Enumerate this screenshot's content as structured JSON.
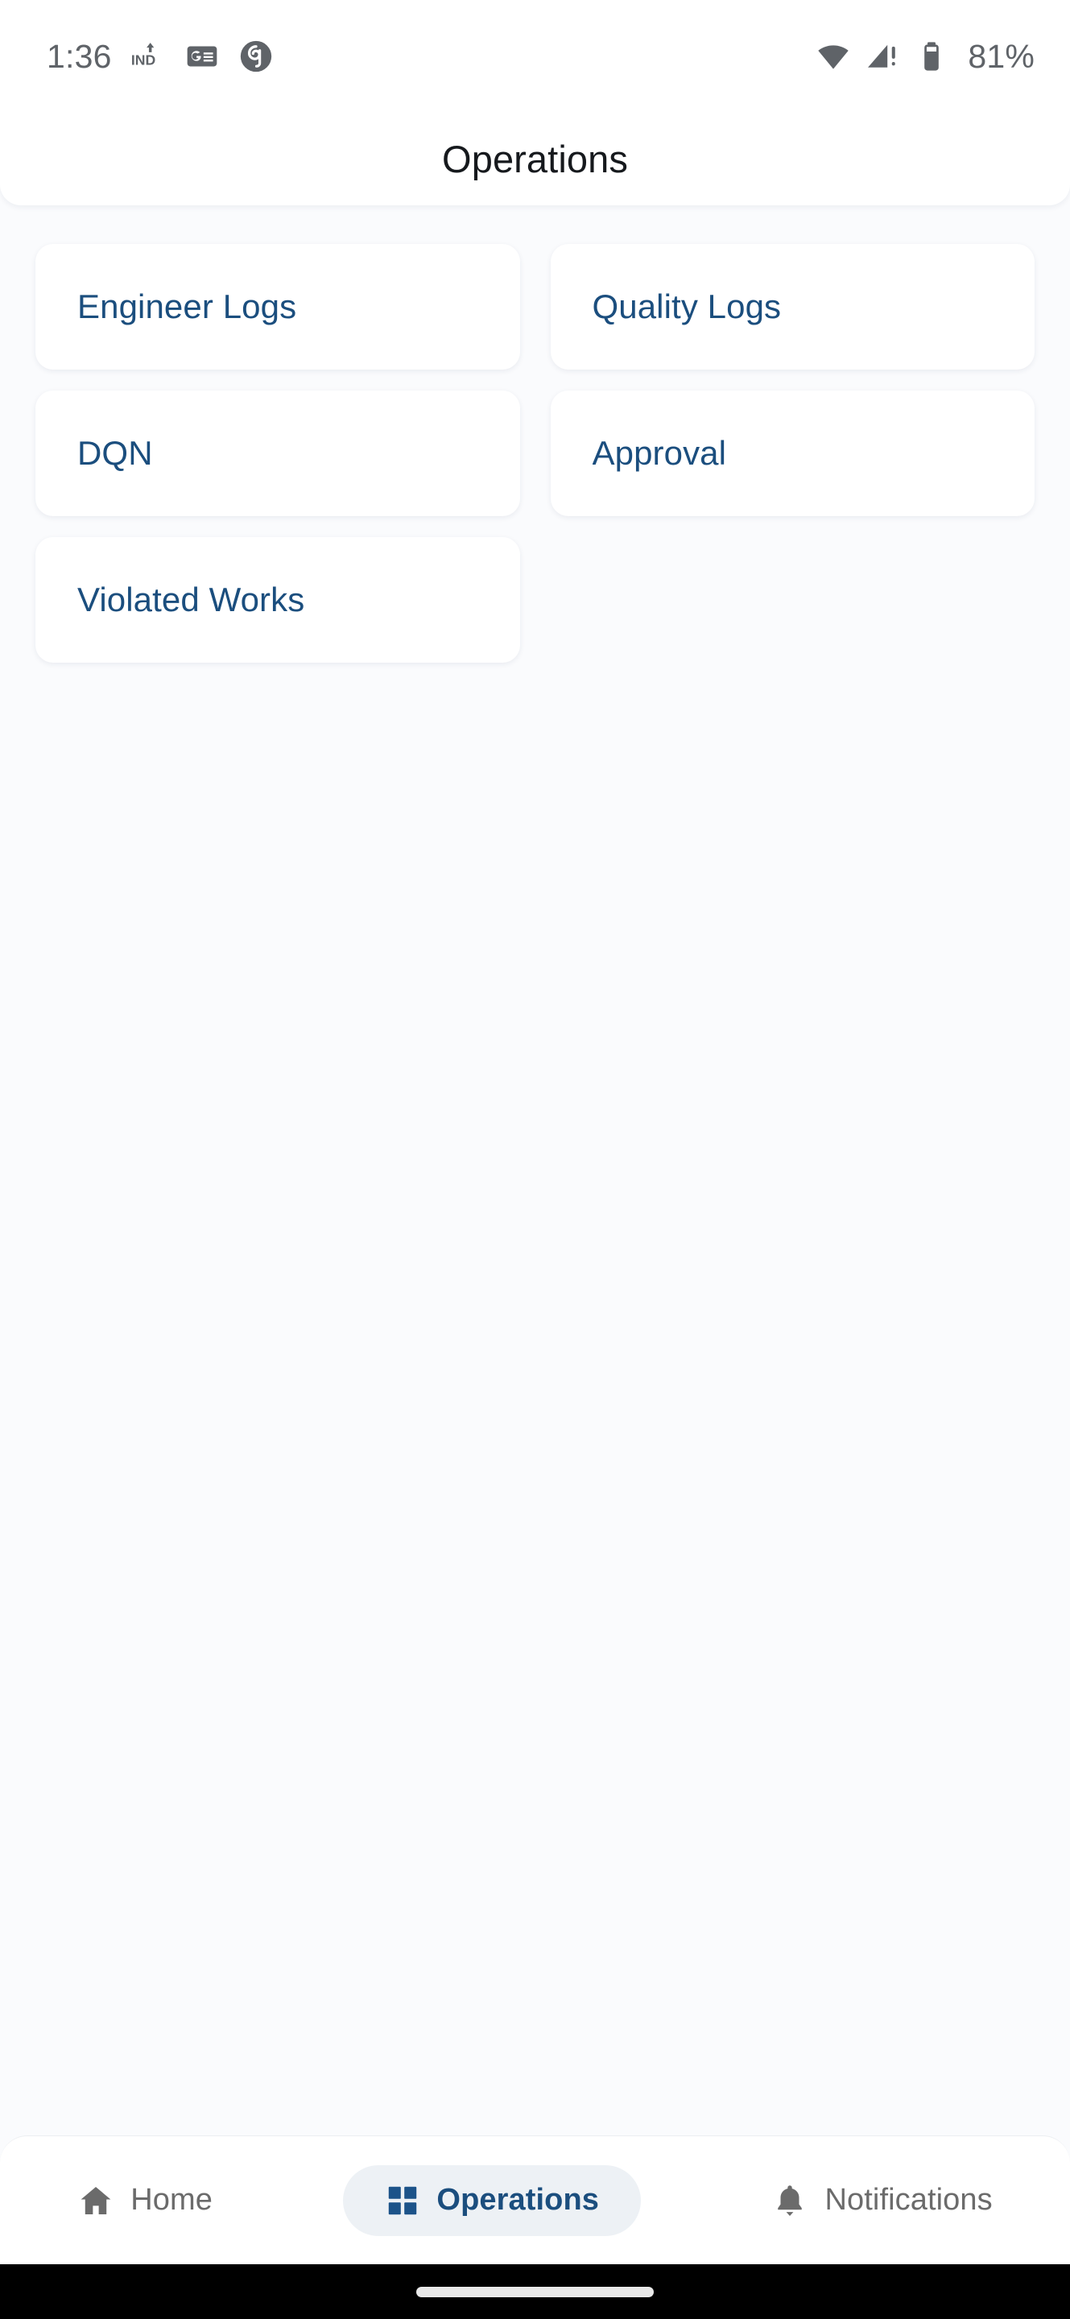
{
  "status_bar": {
    "time": "1:36",
    "battery_percent": "81%",
    "left_icons": [
      "vpn-ind-icon",
      "google-news-icon",
      "spiral-app-icon"
    ],
    "right_icons": [
      "wifi-icon",
      "cellular-signal-warning-icon",
      "battery-icon"
    ],
    "icon_color": "#5f6368",
    "background": "#ffffff"
  },
  "app_bar": {
    "title": "Operations",
    "background": "#ffffff",
    "title_color": "#16191d"
  },
  "content": {
    "background": "#FAFBFD",
    "tiles": [
      {
        "label": "Engineer Logs"
      },
      {
        "label": "Quality Logs"
      },
      {
        "label": "DQN"
      },
      {
        "label": "Approval"
      },
      {
        "label": "Violated Works"
      }
    ],
    "tile_background": "#ffffff",
    "tile_text_color": "#1B4E7E"
  },
  "bottom_nav": {
    "background": "#ffffff",
    "active_pill_color": "#EDF1F5",
    "active_color": "#1B4E7E",
    "inactive_color": "#6b6b6b",
    "items": [
      {
        "label": "Home",
        "icon": "home-icon",
        "active": false
      },
      {
        "label": "Operations",
        "icon": "grid-dashboard-icon",
        "active": true
      },
      {
        "label": "Notifications",
        "icon": "bell-icon",
        "active": false
      }
    ]
  },
  "gesture_bar": {
    "background": "#000000",
    "handle_color": "#e9e9e9"
  }
}
